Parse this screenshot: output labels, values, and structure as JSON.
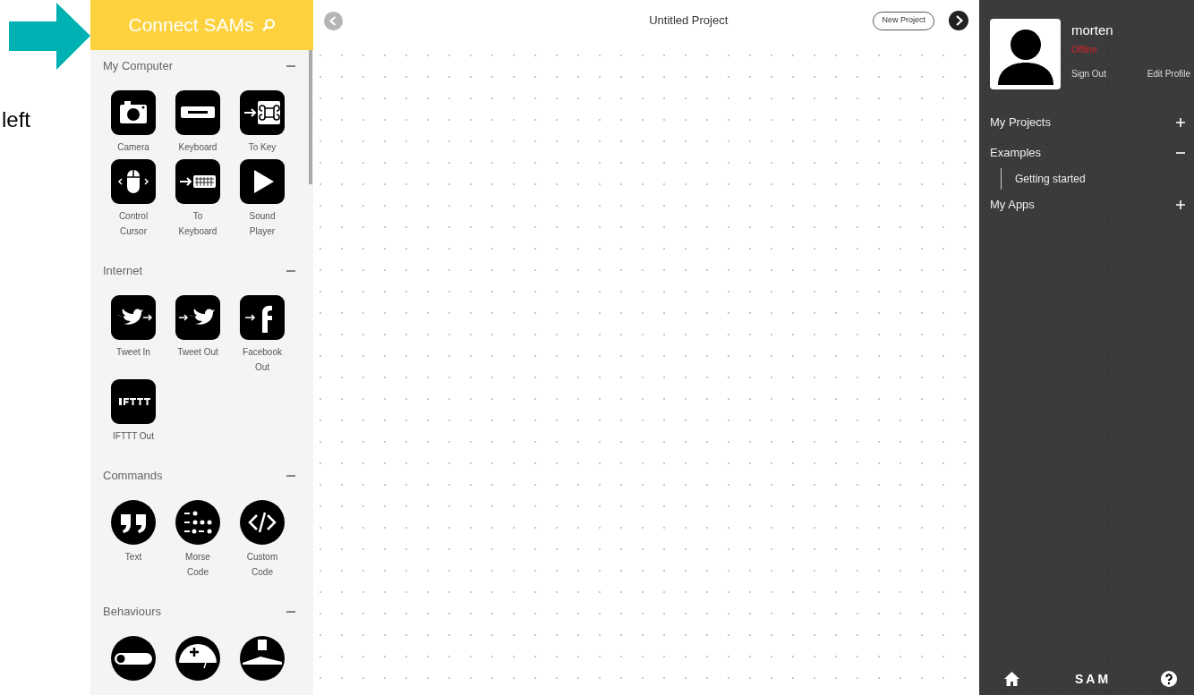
{
  "annotation": {
    "text": "left"
  },
  "sidebar": {
    "header": "Connect SAMs",
    "sections": [
      {
        "title": "My Computer",
        "expanded": true,
        "items": [
          {
            "label": "Camera"
          },
          {
            "label": "Keyboard"
          },
          {
            "label": "To Key"
          },
          {
            "label": "Control Cursor"
          },
          {
            "label": "To Keyboard"
          },
          {
            "label": "Sound Player"
          }
        ]
      },
      {
        "title": "Internet",
        "expanded": true,
        "items": [
          {
            "label": "Tweet In"
          },
          {
            "label": "Tweet Out"
          },
          {
            "label": "Facebook Out"
          },
          {
            "label": "IFTTT Out"
          }
        ]
      },
      {
        "title": "Commands",
        "expanded": true,
        "items": [
          {
            "label": "Text"
          },
          {
            "label": "Morse Code"
          },
          {
            "label": "Custom Code"
          }
        ]
      },
      {
        "title": "Behaviours",
        "expanded": true
      }
    ]
  },
  "toolbar": {
    "title": "Untitled Project",
    "new_project": "New Project"
  },
  "profile": {
    "name": "morten",
    "status": "Offline",
    "sign_out": "Sign Out",
    "edit_profile": "Edit Profile"
  },
  "nav": [
    {
      "label": "My Projects",
      "expanded": false
    },
    {
      "label": "Examples",
      "expanded": true,
      "children": [
        {
          "label": "Getting started"
        }
      ]
    },
    {
      "label": "My Apps",
      "expanded": false
    }
  ],
  "footer": {
    "brand": "SAM"
  }
}
